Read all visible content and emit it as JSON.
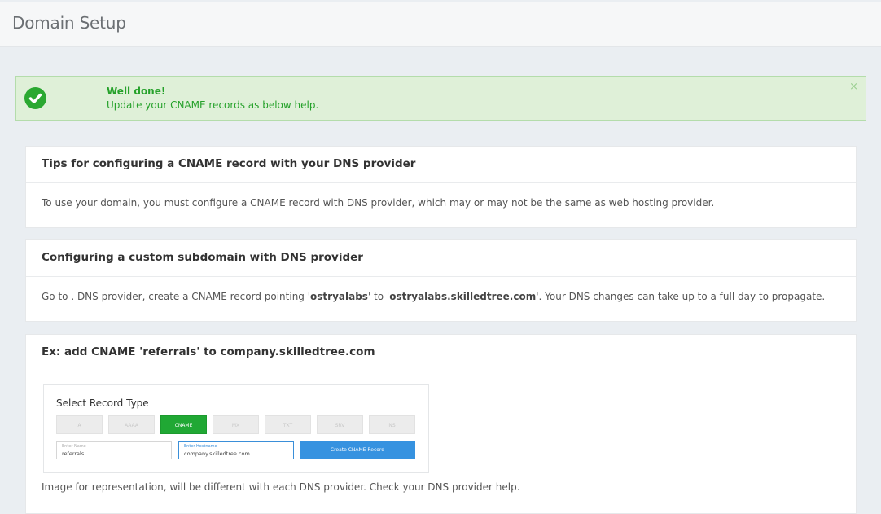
{
  "header": {
    "title": "Domain Setup"
  },
  "alert": {
    "title": "Well done!",
    "message": "Update your CNAME records as below help.",
    "close_label": "×",
    "icon": "check-circle-icon",
    "color": "#25a12a"
  },
  "tips_card": {
    "title": "Tips for configuring a CNAME record with your DNS provider",
    "body": "To use your domain, you must configure a CNAME record with DNS provider, which may or may not be the same as web hosting provider."
  },
  "subdomain_card": {
    "title": "Configuring a custom subdomain with DNS provider",
    "body_prefix": "Go to . DNS provider, create a CNAME record pointing '",
    "subdomain": "ostryalabs",
    "body_middle": "' to '",
    "target": "ostryalabs.skilledtree.com",
    "body_suffix": "'. Your DNS changes can take up to a full day to propagate."
  },
  "example_card": {
    "title": "Ex: add CNAME 'referrals' to company.skilledtree.com",
    "image": {
      "heading": "Select Record Type",
      "record_types": [
        "A",
        "AAAA",
        "CNAME",
        "MX",
        "TXT",
        "SRV",
        "NS"
      ],
      "selected_type": "CNAME",
      "name_label": "Enter Name",
      "name_value": "referrals",
      "hostname_label": "Enter Hostname",
      "hostname_value": "company.skilledtree.com.",
      "create_button": "Create CNAME Record"
    },
    "note": "Image for representation, will be different with each DNS provider. Check your DNS provider help."
  }
}
